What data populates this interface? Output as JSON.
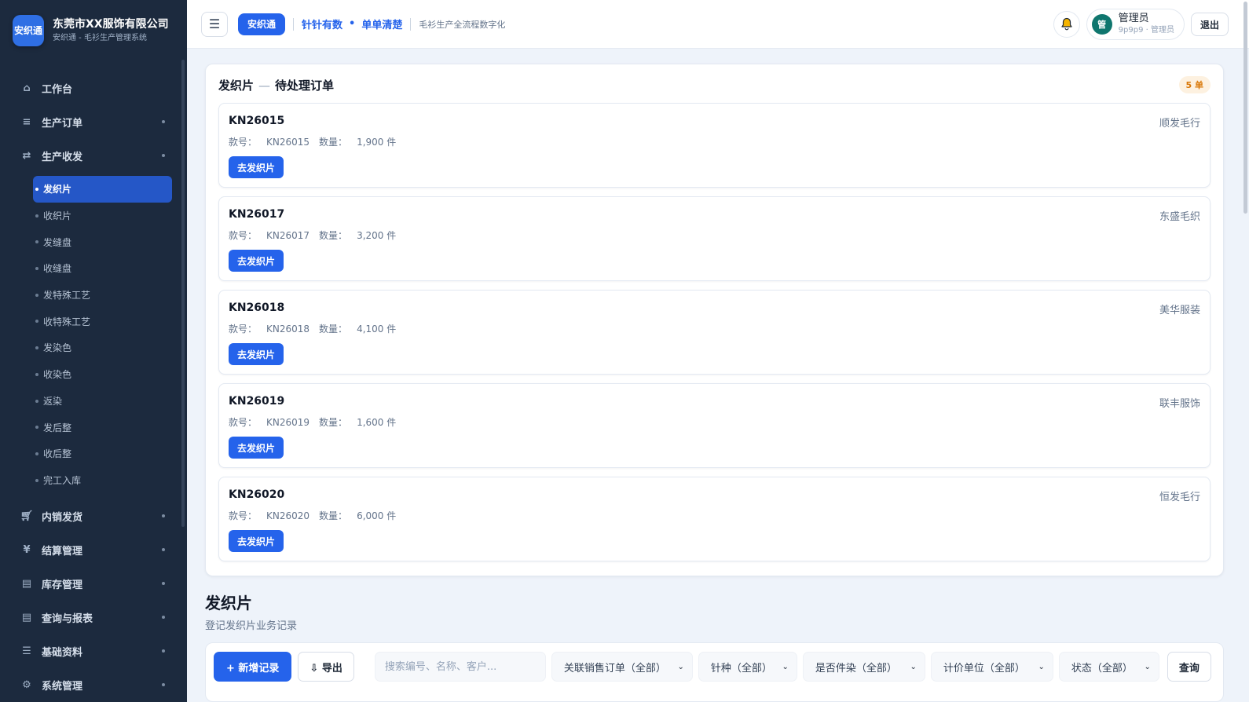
{
  "brand": {
    "logo_text": "安织通",
    "name": "东莞市XX服饰有限公司",
    "subtitle": "安织通 - 毛衫生产管理系统"
  },
  "sidebar": {
    "top_items": [
      {
        "label": "工作台",
        "icon": "home-icon"
      },
      {
        "label": "生产订单",
        "icon": "list-icon"
      },
      {
        "label": "生产收发",
        "icon": "transfer-icon"
      }
    ],
    "sub_items": [
      "发织片",
      "收织片",
      "发缝盘",
      "收缝盘",
      "发特殊工艺",
      "收特殊工艺",
      "发染色",
      "收染色",
      "返染",
      "发后整",
      "收后整",
      "完工入库"
    ],
    "active_sub": "发织片",
    "bottom_items": [
      {
        "label": "内销发货",
        "icon": "cart-icon"
      },
      {
        "label": "结算管理",
        "icon": "yen-icon"
      },
      {
        "label": "库存管理",
        "icon": "box-icon"
      },
      {
        "label": "查询与报表",
        "icon": "report-icon"
      },
      {
        "label": "基础资料",
        "icon": "list-icon"
      },
      {
        "label": "系统管理",
        "icon": "gear-icon"
      }
    ]
  },
  "topbar": {
    "app_pill": "安织通",
    "slogan_left": "针针有数",
    "slogan_dot": "•",
    "slogan_right": "单单清楚",
    "tagline": "毛衫生产全流程数字化",
    "user_avatar": "管",
    "user_name": "管理员",
    "user_meta": "9p9p9 · 管理员",
    "logout": "退出"
  },
  "pending": {
    "title": "发织片",
    "title_sep": "—",
    "title_suffix": "待处理订单",
    "count": "5 单",
    "style_label": "款号：",
    "qty_label": "数量：",
    "orders": [
      {
        "code": "KN26015",
        "customer": "顺发毛行",
        "style": "KN26015",
        "qty": "1,900 件",
        "action": "去发织片"
      },
      {
        "code": "KN26017",
        "customer": "东盛毛织",
        "style": "KN26017",
        "qty": "3,200 件",
        "action": "去发织片"
      },
      {
        "code": "KN26018",
        "customer": "美华服装",
        "style": "KN26018",
        "qty": "4,100 件",
        "action": "去发织片"
      },
      {
        "code": "KN26019",
        "customer": "联丰服饰",
        "style": "KN26019",
        "qty": "1,600 件",
        "action": "去发织片"
      },
      {
        "code": "KN26020",
        "customer": "恒发毛行",
        "style": "KN26020",
        "qty": "6,000 件",
        "action": "去发织片"
      }
    ]
  },
  "section": {
    "title": "发织片",
    "subtitle": "登记发织片业务记录"
  },
  "toolbar": {
    "add_label": "+ 新增记录",
    "export_label": "⇩ 导出",
    "search_placeholder": "搜索编号、名称、客户...",
    "filters": [
      "关联销售订单（全部）",
      "针种（全部）",
      "是否件染（全部）",
      "计价单位（全部）",
      "状态（全部）"
    ],
    "query_label": "查询"
  },
  "colors": {
    "sidebar_bg": "#1c2a3e",
    "accent": "#2563eb",
    "badge_text": "#d97706",
    "badge_bg": "#fdf1e0"
  }
}
